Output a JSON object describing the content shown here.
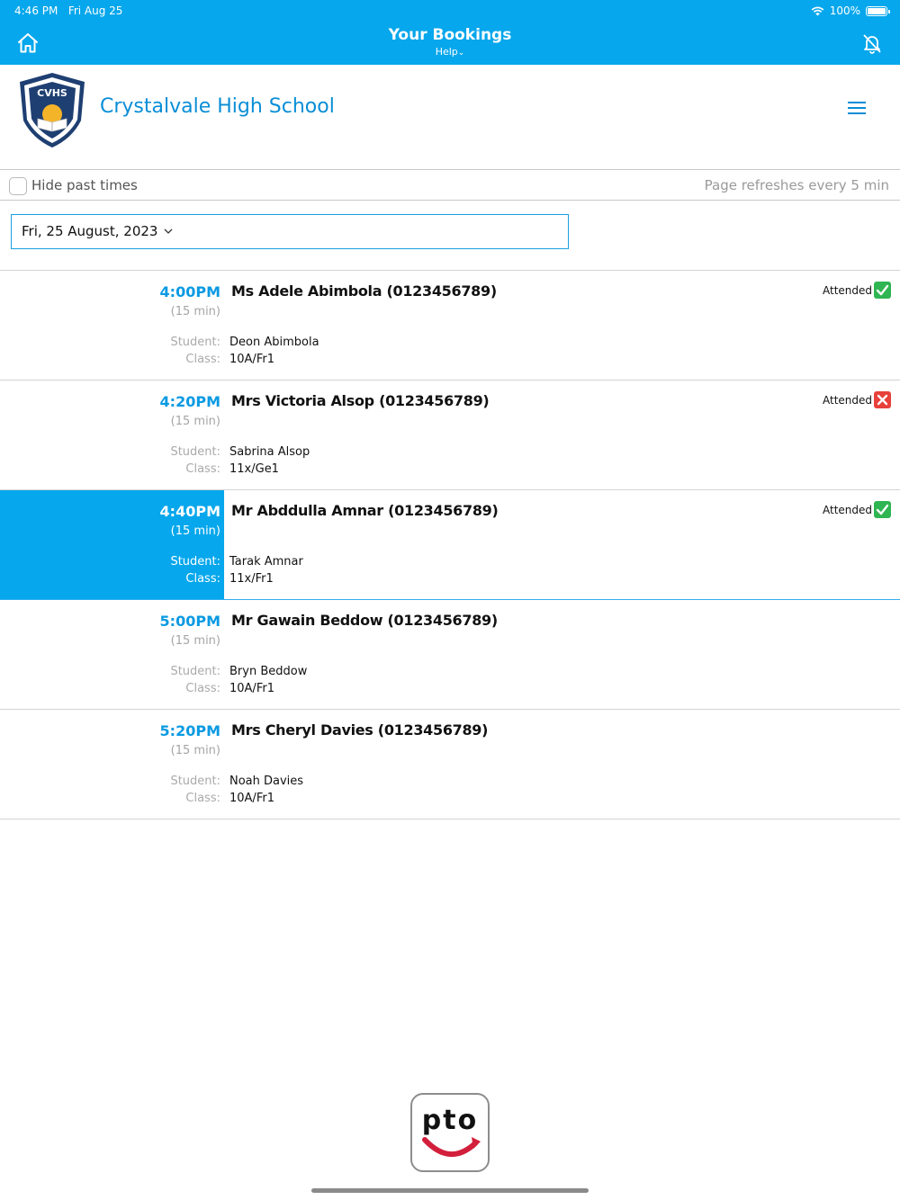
{
  "status_bar": {
    "time": "4:46 PM",
    "date": "Fri Aug 25",
    "battery": "100%"
  },
  "header": {
    "title": "Your Bookings",
    "help_label": "Help",
    "help_chevron": "⌄"
  },
  "school": {
    "name": "Crystalvale High School",
    "crest_text": "CVHS"
  },
  "options": {
    "hide_past_label": "Hide past times",
    "hide_past_checked": false,
    "refresh_note": "Page refreshes every 5 min"
  },
  "date_select": {
    "value": "Fri, 25 August, 2023"
  },
  "labels": {
    "student": "Student:",
    "class": "Class:",
    "attended": "Attended"
  },
  "bookings": [
    {
      "time": "4:00PM",
      "duration": "(15 min)",
      "teacher": "Ms Adele Abimbola (0123456789)",
      "student": "Deon Abimbola",
      "class": "10A/Fr1",
      "attended": true,
      "selected": false
    },
    {
      "time": "4:20PM",
      "duration": "(15 min)",
      "teacher": "Mrs Victoria Alsop (0123456789)",
      "student": "Sabrina Alsop",
      "class": "11x/Ge1",
      "attended": false,
      "selected": false
    },
    {
      "time": "4:40PM",
      "duration": "(15 min)",
      "teacher": "Mr Abddulla Amnar (0123456789)",
      "student": "Tarak Amnar",
      "class": "11x/Fr1",
      "attended": true,
      "selected": true
    },
    {
      "time": "5:00PM",
      "duration": "(15 min)",
      "teacher": "Mr Gawain Beddow (0123456789)",
      "student": "Bryn Beddow",
      "class": "10A/Fr1",
      "attended": null,
      "selected": false
    },
    {
      "time": "5:20PM",
      "duration": "(15 min)",
      "teacher": "Mrs Cheryl Davies (0123456789)",
      "student": "Noah Davies",
      "class": "10A/Fr1",
      "attended": null,
      "selected": false
    }
  ],
  "footer": {
    "logo_text": "pto"
  },
  "colors": {
    "accent": "#06a7ec",
    "link": "#0a8ed6",
    "attended_yes": "#2fb552",
    "attended_no": "#e8403a"
  }
}
